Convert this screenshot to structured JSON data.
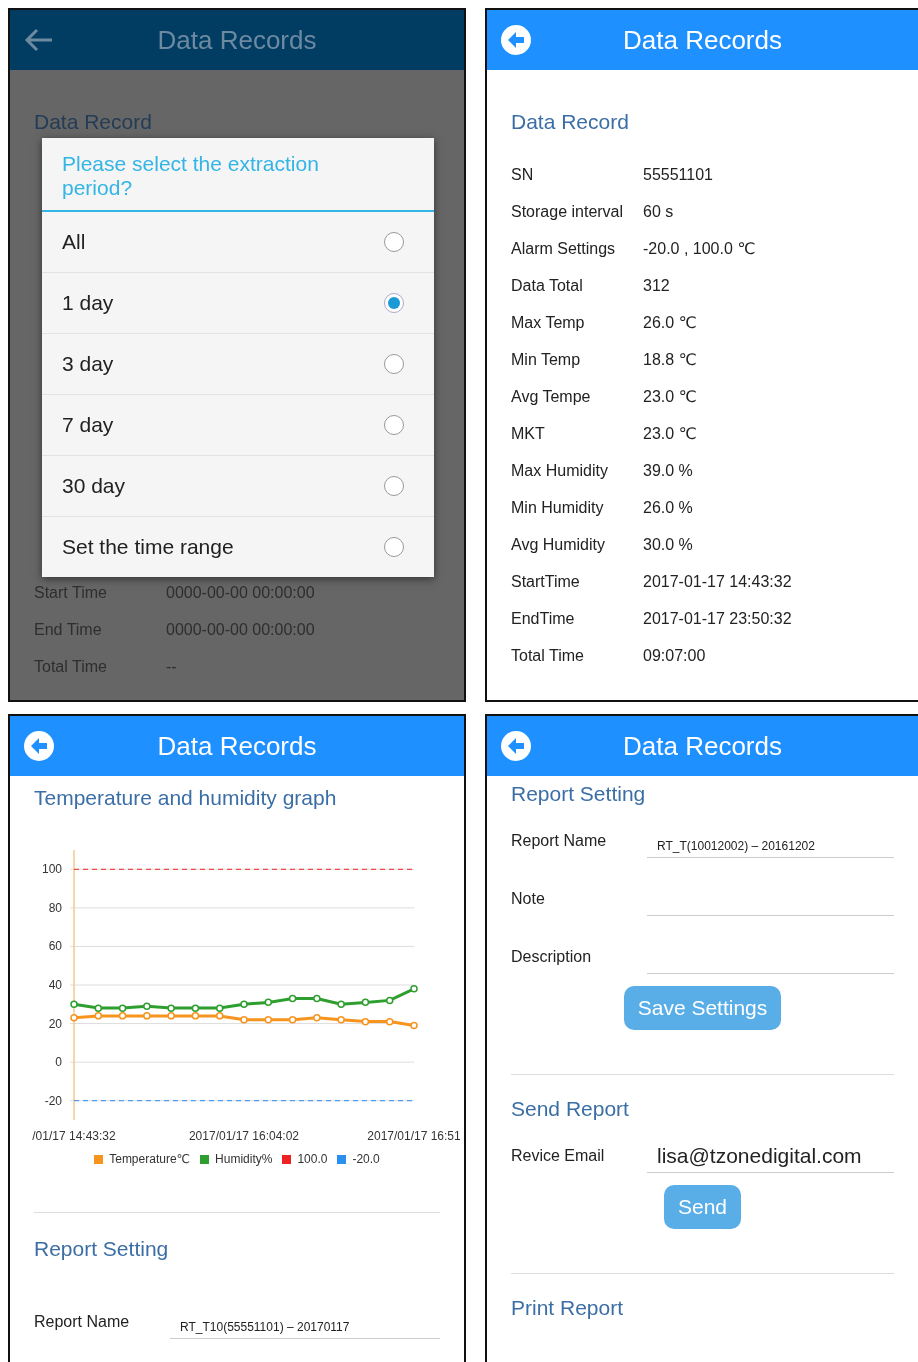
{
  "panels": [
    {
      "kind": "dialog_over_record",
      "header": {
        "title": "Data Records",
        "dimmed": true
      },
      "section_title": "Data Record",
      "rows": [
        {
          "label": "Start Time",
          "value": "0000-00-00 00:00:00"
        },
        {
          "label": "End Time",
          "value": "0000-00-00 00:00:00"
        },
        {
          "label": "Total Time",
          "value": "--"
        }
      ],
      "dialog": {
        "title": "Please select the extraction period?",
        "options": [
          {
            "label": "All",
            "selected": false
          },
          {
            "label": "1 day",
            "selected": true
          },
          {
            "label": "3 day",
            "selected": false
          },
          {
            "label": "7 day",
            "selected": false
          },
          {
            "label": "30 day",
            "selected": false
          },
          {
            "label": "Set the time range",
            "selected": false
          }
        ]
      }
    },
    {
      "kind": "record",
      "header": {
        "title": "Data Records",
        "dimmed": false
      },
      "section_title": "Data Record",
      "rows": [
        {
          "label": "SN",
          "value": "55551101"
        },
        {
          "label": "Storage interval",
          "value": "60 s"
        },
        {
          "label": "Alarm Settings",
          "value": "-20.0 , 100.0 ℃"
        },
        {
          "label": "Data Total",
          "value": "312"
        },
        {
          "label": "Max Temp",
          "value": "26.0 ℃"
        },
        {
          "label": "Min Temp",
          "value": "18.8 ℃"
        },
        {
          "label": "Avg Tempe",
          "value": "23.0 ℃"
        },
        {
          "label": "MKT",
          "value": "23.0 ℃"
        },
        {
          "label": "Max Humidity",
          "value": "39.0 %"
        },
        {
          "label": "Min Humidity",
          "value": "26.0 %"
        },
        {
          "label": "Avg Humidity",
          "value": "30.0 %"
        },
        {
          "label": "StartTime",
          "value": "2017-01-17 14:43:32"
        },
        {
          "label": "EndTime",
          "value": "2017-01-17 23:50:32"
        },
        {
          "label": "Total Time",
          "value": "09:07:00"
        }
      ]
    },
    {
      "kind": "graph",
      "header": {
        "title": "Data Records",
        "dimmed": false
      },
      "section_title": "Temperature and humidity graph",
      "chart_data": {
        "type": "line",
        "categories": [
          "/01/17 14:43:32",
          null,
          null,
          null,
          null,
          null,
          null,
          "2017/01/17 16:04:02",
          null,
          null,
          null,
          null,
          null,
          null,
          "2017/01/17 16:51"
        ],
        "ylim": [
          -30,
          110
        ],
        "yticks": [
          -20,
          0,
          20,
          40,
          60,
          80,
          100
        ],
        "grid": true,
        "legend": true,
        "series": [
          {
            "name": "Temperature℃",
            "color": "#f7941d",
            "marker": "circle",
            "line_style": "solid",
            "values": [
              23,
              24,
              24,
              24,
              24,
              24,
              24,
              22,
              22,
              22,
              23,
              22,
              21,
              21,
              19
            ]
          },
          {
            "name": "Humidity%",
            "color": "#2e9e2e",
            "marker": "circle",
            "line_style": "solid",
            "values": [
              30,
              28,
              28,
              29,
              28,
              28,
              28,
              30,
              31,
              33,
              33,
              30,
              31,
              32,
              38
            ]
          },
          {
            "name": "100.0",
            "color": "#ee2222",
            "line_style": "dashed",
            "values": [
              100,
              100,
              100,
              100,
              100,
              100,
              100,
              100,
              100,
              100,
              100,
              100,
              100,
              100,
              100
            ]
          },
          {
            "name": "-20.0",
            "color": "#2b8ff0",
            "line_style": "dashed",
            "values": [
              -20,
              -20,
              -20,
              -20,
              -20,
              -20,
              -20,
              -20,
              -20,
              -20,
              -20,
              -20,
              -20,
              -20,
              -20
            ]
          }
        ]
      },
      "sections": [
        {
          "title": "Report Setting",
          "fields": [
            {
              "label": "Report Name",
              "value": "RT_T10(55551101) – 20170117",
              "kind": "name"
            }
          ]
        }
      ]
    },
    {
      "kind": "form",
      "header": {
        "title": "Data Records",
        "dimmed": false
      },
      "sections": [
        {
          "title": "Report Setting",
          "fields": [
            {
              "label": "Report Name",
              "value": "RT_T(10012002) – 20161202",
              "kind": "name"
            },
            {
              "label": "Note",
              "kind": "text"
            },
            {
              "label": "Description",
              "kind": "text"
            }
          ],
          "button": "Save Settings"
        },
        {
          "title": "Send Report",
          "fields": [
            {
              "label": "Revice Email",
              "value": "lisa@tzonedigital.com",
              "kind": "email"
            }
          ],
          "button": "Send"
        },
        {
          "title": "Print Report"
        }
      ]
    }
  ]
}
